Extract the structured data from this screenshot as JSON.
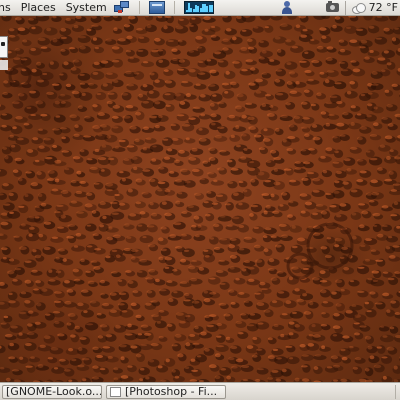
{
  "top_panel": {
    "menus": [
      "ns",
      "Places",
      "System"
    ],
    "weather": {
      "temperature": "72 °F"
    }
  },
  "taskbar": {
    "tasks": [
      {
        "label": "[GNOME-Look.o..."
      },
      {
        "label": "[Photoshop - Fi..."
      }
    ]
  }
}
